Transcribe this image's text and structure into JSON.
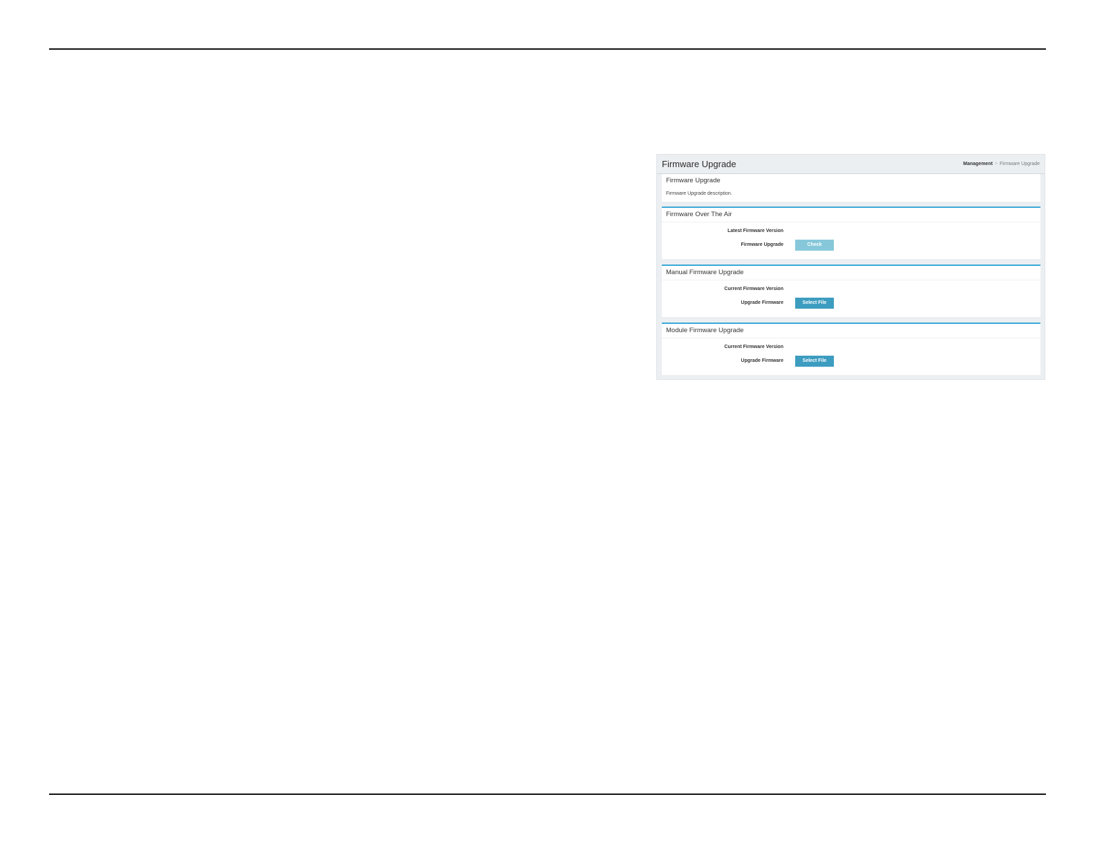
{
  "header": {
    "title": "Firmware Upgrade",
    "breadcrumb": {
      "root": "Management",
      "separator": ">",
      "current": "Firmware Upgrade"
    }
  },
  "panels": [
    {
      "title": "Firmware Upgrade",
      "description": "Firmware Upgrade description."
    },
    {
      "title": "Firmware Over The Air",
      "fields": [
        {
          "label": "Latest Firmware Version"
        },
        {
          "label": "Firmware Upgrade",
          "button": "Check",
          "button_state": "disabled"
        }
      ]
    },
    {
      "title": "Manual Firmware Upgrade",
      "fields": [
        {
          "label": "Current Firmware Version"
        },
        {
          "label": "Upgrade Firmware",
          "button": "Select File"
        }
      ]
    },
    {
      "title": "Module Firmware Upgrade",
      "fields": [
        {
          "label": "Current Firmware Version"
        },
        {
          "label": "Upgrade Firmware",
          "button": "Select File"
        }
      ]
    }
  ],
  "colors": {
    "accent": "#3aa8d6",
    "button_primary": "#3d9dc0",
    "button_disabled": "#86c8da",
    "panel_background": "#eceff2"
  }
}
